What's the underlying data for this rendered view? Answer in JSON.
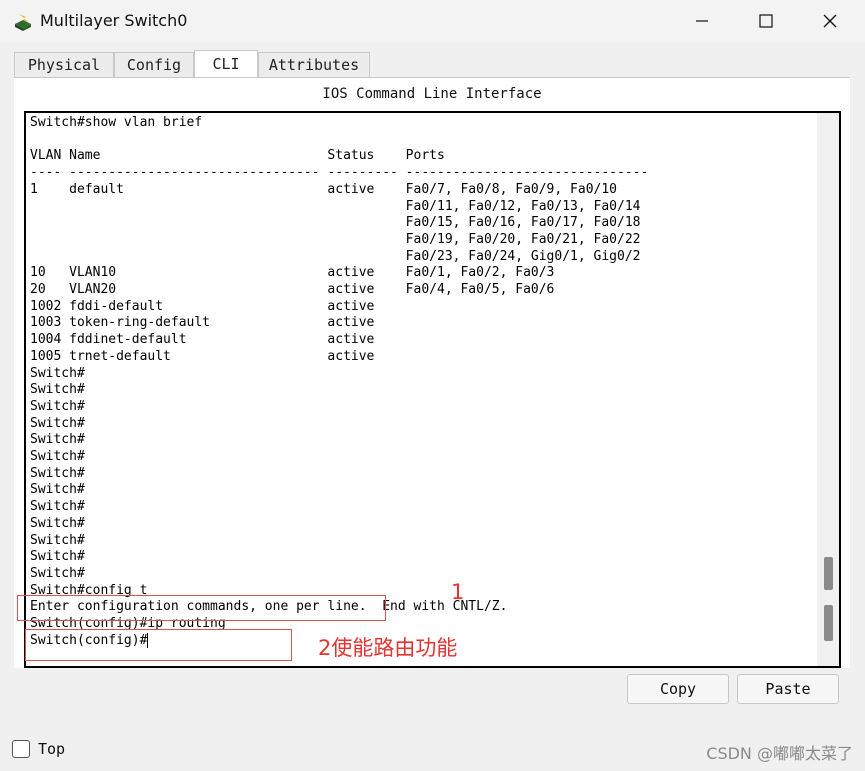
{
  "window": {
    "title": "Multilayer Switch0"
  },
  "tabs": [
    {
      "label": "Physical"
    },
    {
      "label": "Config"
    },
    {
      "label": "CLI"
    },
    {
      "label": "Attributes"
    }
  ],
  "panel_title": "IOS Command Line Interface",
  "terminal": {
    "lines": [
      "Switch#show vlan brief",
      "",
      "VLAN Name                             Status    Ports",
      "---- -------------------------------- --------- -------------------------------",
      "1    default                          active    Fa0/7, Fa0/8, Fa0/9, Fa0/10",
      "                                                Fa0/11, Fa0/12, Fa0/13, Fa0/14",
      "                                                Fa0/15, Fa0/16, Fa0/17, Fa0/18",
      "                                                Fa0/19, Fa0/20, Fa0/21, Fa0/22",
      "                                                Fa0/23, Fa0/24, Gig0/1, Gig0/2",
      "10   VLAN10                           active    Fa0/1, Fa0/2, Fa0/3",
      "20   VLAN20                           active    Fa0/4, Fa0/5, Fa0/6",
      "1002 fddi-default                     active",
      "1003 token-ring-default               active",
      "1004 fddinet-default                  active",
      "1005 trnet-default                    active",
      "Switch#",
      "Switch#",
      "Switch#",
      "Switch#",
      "Switch#",
      "Switch#",
      "Switch#",
      "Switch#",
      "Switch#",
      "Switch#",
      "Switch#",
      "Switch#",
      "Switch#",
      "Switch#config t",
      "Enter configuration commands, one per line.  End with CNTL/Z.",
      "Switch(config)#ip routing",
      "Switch(config)#"
    ]
  },
  "annotations": {
    "label1": "1",
    "label2": "2使能路由功能",
    "color": "#e8322f"
  },
  "buttons": {
    "copy": "Copy",
    "paste": "Paste"
  },
  "footer": {
    "top_label": "Top",
    "top_checked": false,
    "watermark": "CSDN @嘟嘟太菜了"
  }
}
